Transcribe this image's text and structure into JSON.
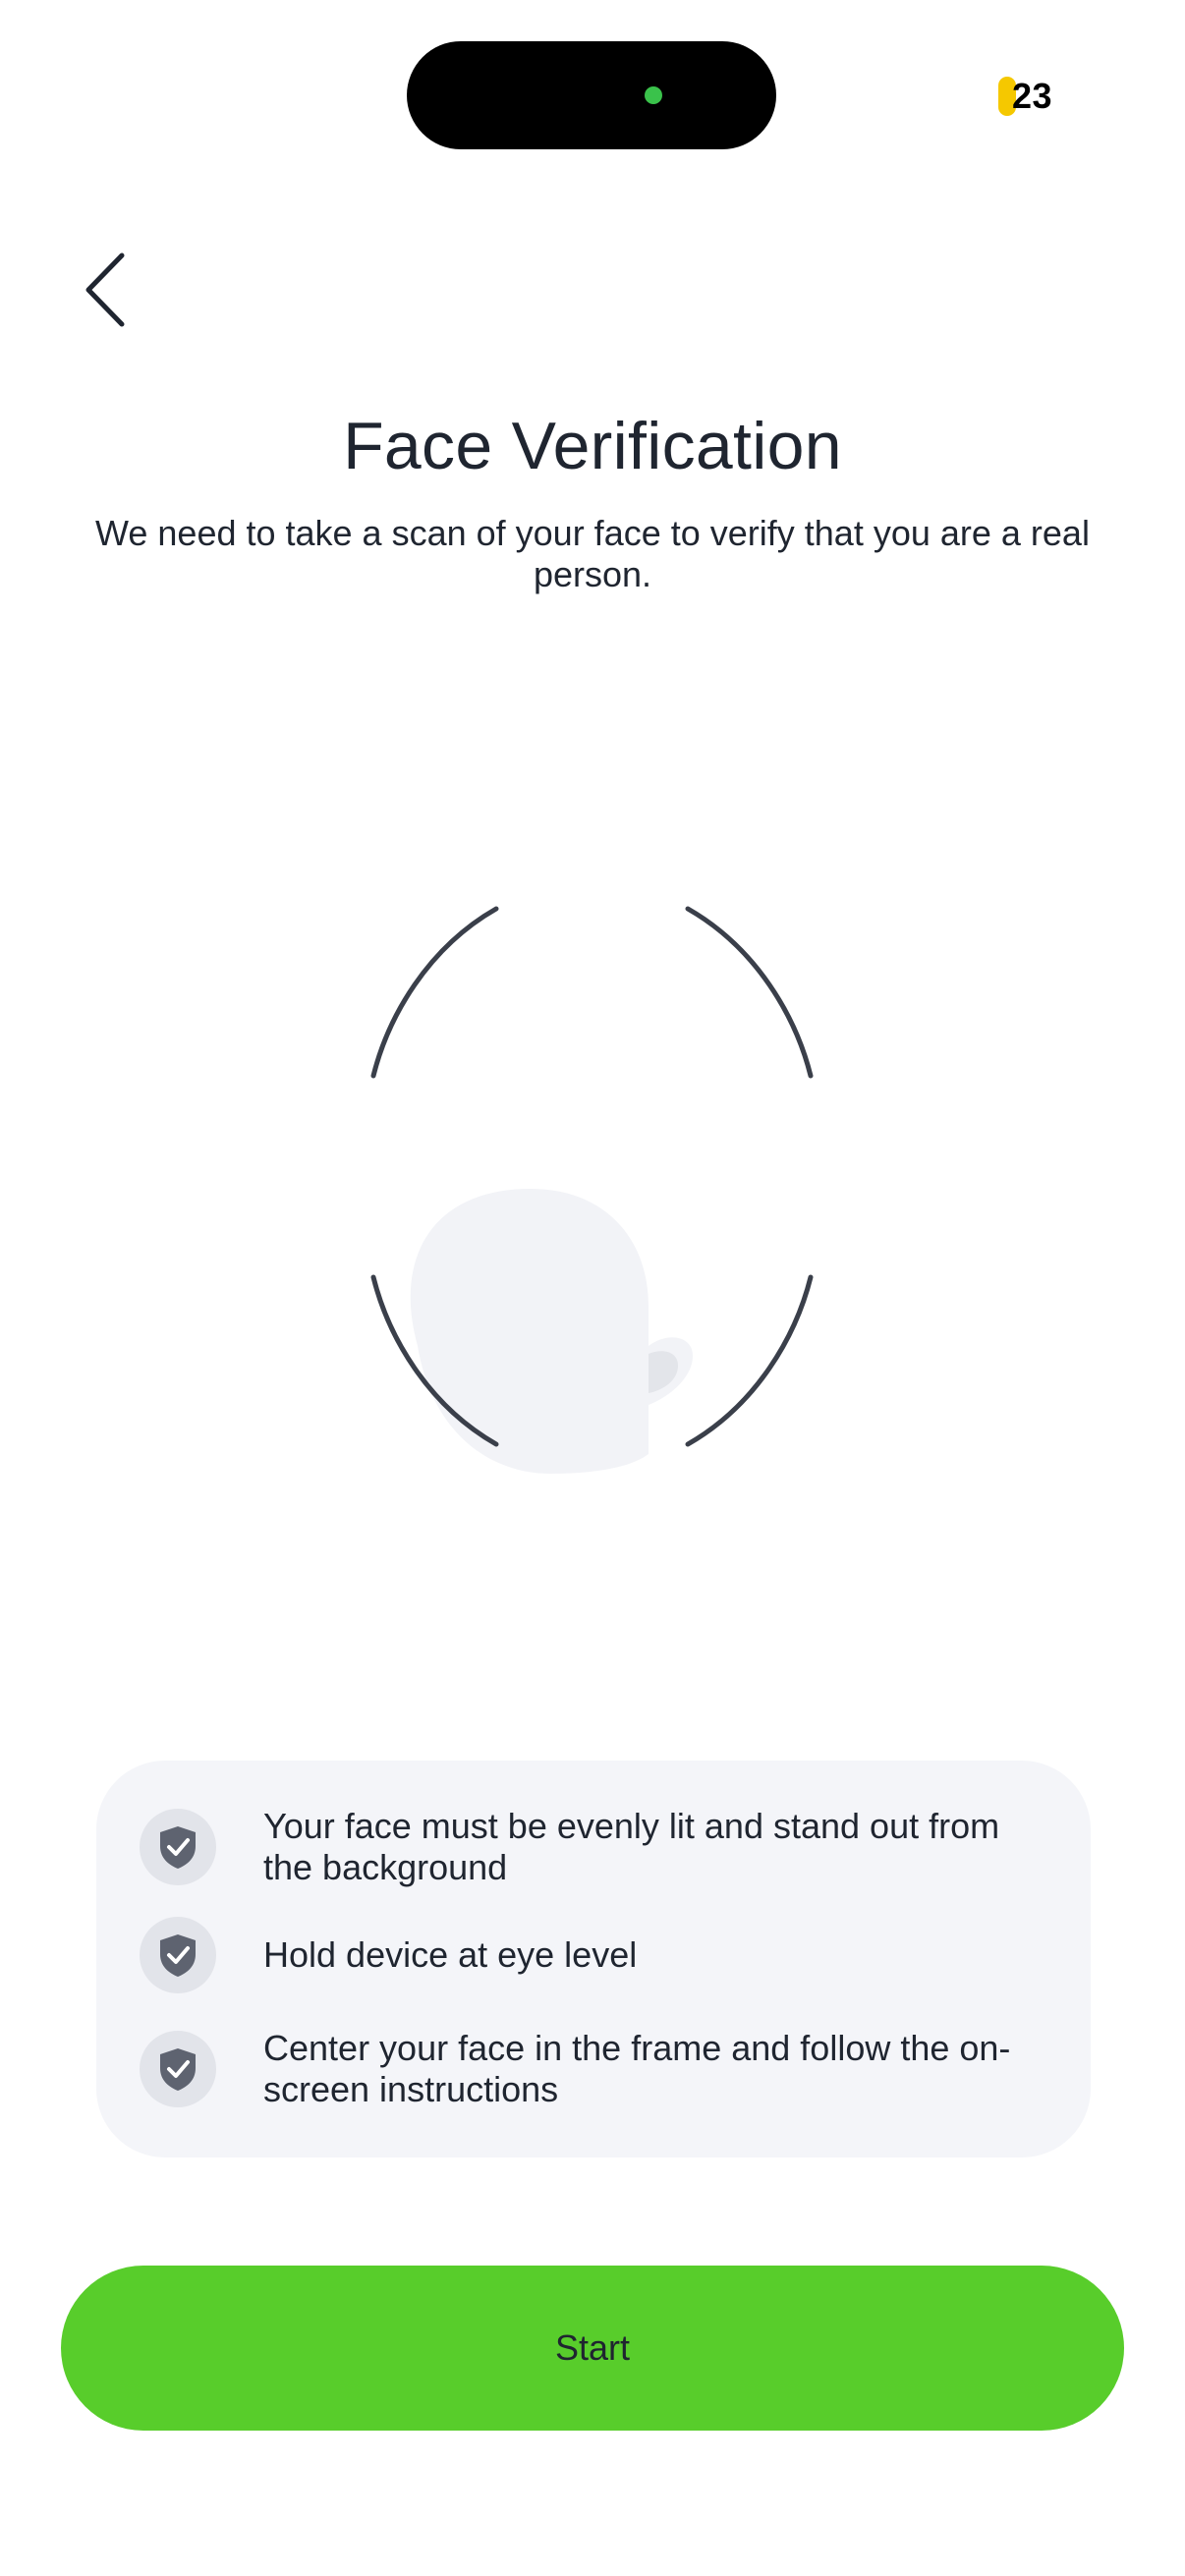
{
  "status_bar": {
    "time_badge": "23"
  },
  "header": {
    "back_icon": "chevron-left-icon"
  },
  "page": {
    "title": "Face Verification",
    "subtitle": "We need to take a scan of your face to verify that you are a real person."
  },
  "tips": {
    "icon": "shield-check-icon",
    "items": [
      {
        "text": "Your face must be evenly lit and stand out from the background"
      },
      {
        "text": "Hold device at eye level"
      },
      {
        "text": "Center your face in the frame and follow the on-screen instructions"
      }
    ]
  },
  "actions": {
    "start_label": "Start"
  },
  "colors": {
    "accent": "#58cd2b",
    "text": "#1f2530",
    "card_bg": "#f4f5f9",
    "icon_bg": "#e2e4ea",
    "icon": "#5e6370",
    "frame_stroke": "#3a3f4a",
    "status_pill": "#f5c800"
  }
}
